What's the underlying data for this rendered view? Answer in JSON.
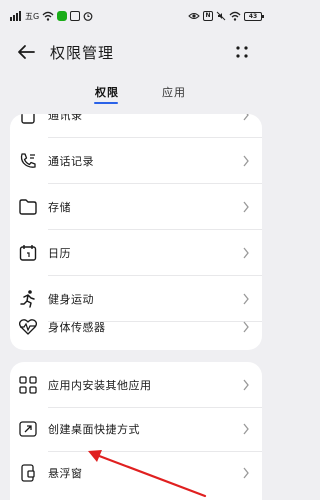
{
  "statusbar": {
    "left_text": "lli",
    "carrier_badge": "五G",
    "right_badge": "N",
    "battery": "43",
    "icon_names": [
      "signal-icon",
      "wifi-icon",
      "chat-icon",
      "message-icon",
      "alarm-icon",
      "eye-icon",
      "nfc-icon",
      "mute-icon",
      "wifi-status-icon",
      "battery-icon"
    ]
  },
  "header": {
    "title": "权限管理",
    "back_icon": "back-arrow-icon",
    "more_icon": "more-dots-icon"
  },
  "tabs": [
    {
      "label": "权限",
      "active": true
    },
    {
      "label": "应用",
      "active": false
    }
  ],
  "accent_color": "#2a62e8",
  "group1": {
    "items": [
      {
        "label": "通讯录",
        "icon": "contacts-icon"
      },
      {
        "label": "通话记录",
        "icon": "call-log-icon"
      },
      {
        "label": "存储",
        "icon": "folder-icon"
      },
      {
        "label": "日历",
        "icon": "calendar-icon"
      },
      {
        "label": "健身运动",
        "icon": "running-icon"
      },
      {
        "label": "身体传感器",
        "icon": "heart-rate-icon"
      }
    ]
  },
  "group2": {
    "items": [
      {
        "label": "应用内安装其他应用",
        "icon": "install-apps-icon"
      },
      {
        "label": "创建桌面快捷方式",
        "icon": "shortcut-icon"
      },
      {
        "label": "悬浮窗",
        "icon": "floating-window-icon"
      }
    ]
  },
  "annotation": {
    "icon": "red-arrow-icon",
    "color": "#e02020"
  }
}
